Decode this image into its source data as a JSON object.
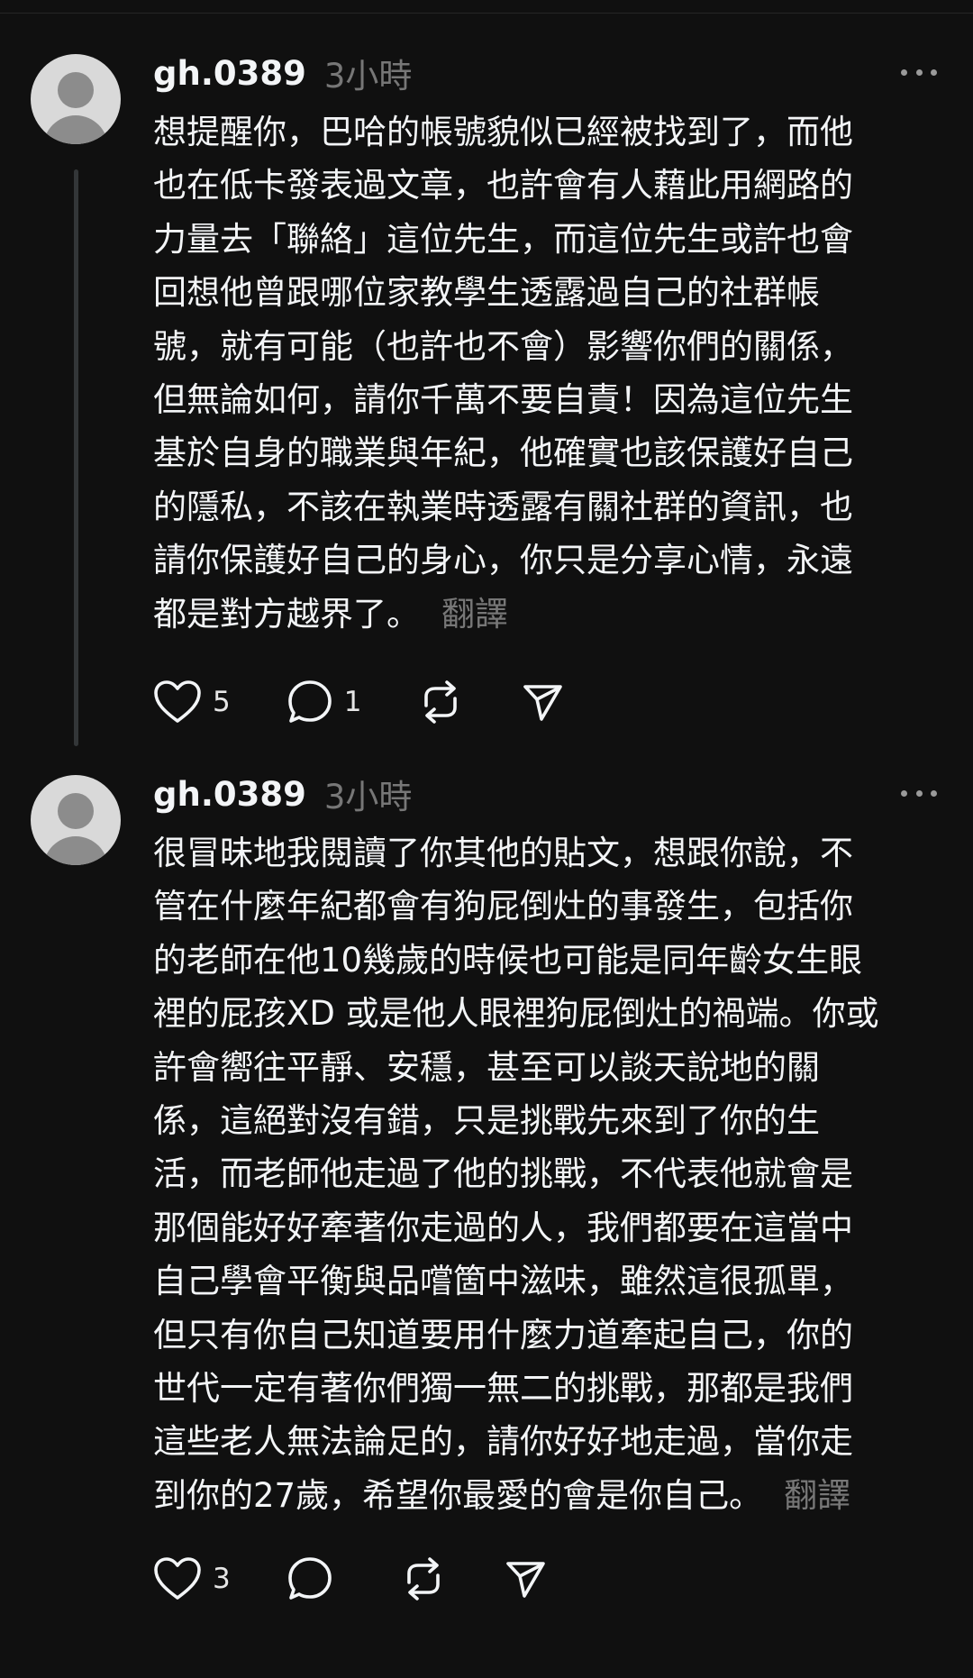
{
  "posts": [
    {
      "username": "gh.0389",
      "time": "3小時",
      "lines": [
        "想提醒你，巴哈的帳號貌似已經被找到了，而他",
        "也在低卡發表過文章，也許會有人藉此用網路的",
        "力量去「聯絡」這位先生，而這位先生或許也會",
        "回想他曾跟哪位家教學生透露過自己的社群帳",
        "號，就有可能（也許也不會）影響你們的關係，",
        "但無論如何，請你千萬不要自責！因為這位先生",
        "基於自身的職業與年紀，他確實也該保護好自己",
        "的隱私，不該在執業時透露有關社群的資訊，也",
        "請你保護好自己的身心，你只是分享心情，永遠",
        "都是對方越界了。"
      ],
      "translate_label": "翻譯",
      "like_count": "5",
      "reply_count": "1"
    },
    {
      "username": "gh.0389",
      "time": "3小時",
      "lines": [
        "很冒昧地我閱讀了你其他的貼文，想跟你說，不",
        "管在什麼年紀都會有狗屁倒灶的事發生，包括你",
        "的老師在他10幾歲的時候也可能是同年齡女生眼",
        "裡的屁孩XD 或是他人眼裡狗屁倒灶的禍端。你或",
        "許會嚮往平靜、安穩，甚至可以談天說地的關",
        "係，這絕對沒有錯，只是挑戰先來到了你的生",
        "活，而老師他走過了他的挑戰，不代表他就會是",
        "那個能好好牽著你走過的人，我們都要在這當中",
        "自己學會平衡與品嚐箇中滋味，雖然這很孤單，",
        "但只有你自己知道要用什麼力道牽起自己，你的",
        "世代一定有著你們獨一無二的挑戰，那都是我們",
        "這些老人無法論足的，請你好好地走過，當你走",
        "到你的27歲，希望你最愛的會是你自己。"
      ],
      "translate_label": "翻譯",
      "like_count": "3",
      "reply_count": ""
    }
  ],
  "icons": {
    "like": "heart-icon",
    "reply": "speech-bubble-icon",
    "repost": "repost-arrows-icon",
    "share": "paper-plane-icon",
    "more": "more-dots-icon"
  },
  "colors": {
    "background": "#101010",
    "primary_text": "#f3f5f7",
    "secondary_text": "#777777",
    "thread_line": "#333638",
    "avatar_bg": "#d9d9d9",
    "avatar_fg": "#8c8c8c"
  }
}
